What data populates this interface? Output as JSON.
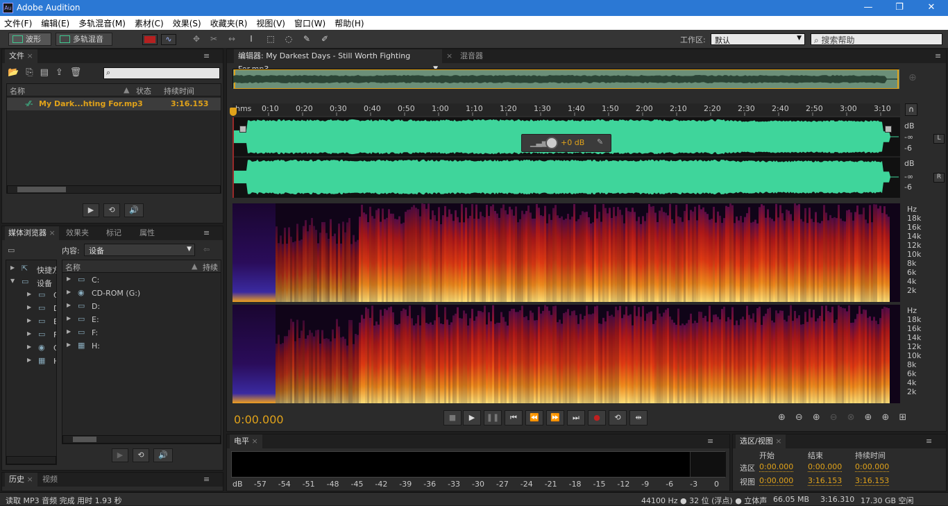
{
  "app": {
    "title": "Adobe Audition",
    "icon": "Au"
  },
  "window": {
    "min": "—",
    "max": "❐",
    "close": "✕"
  },
  "menu": [
    "文件(F)",
    "编辑(E)",
    "多轨混音(M)",
    "素材(C)",
    "效果(S)",
    "收藏夹(R)",
    "视图(V)",
    "窗口(W)",
    "帮助(H)"
  ],
  "toolbar": {
    "waveform": "波形",
    "multitrack": "多轨混音",
    "workspace_label": "工作区:",
    "workspace_value": "默认",
    "search_placeholder": "搜索帮助"
  },
  "files": {
    "tab": "文件",
    "cols": [
      "名称",
      "状态",
      "持续时间"
    ],
    "items": [
      {
        "name": "My Dark...hting For.mp3",
        "duration": "3:16.153"
      }
    ]
  },
  "media": {
    "tabs": [
      "媒体浏览器",
      "效果夹",
      "标记",
      "属性"
    ],
    "content_label": "内容:",
    "content_value": "设备",
    "left_items": [
      "快捷方",
      "设备",
      "C:",
      "D:",
      "E:",
      "F:",
      "C:",
      "H:"
    ],
    "right_header": [
      "名称",
      "持续"
    ],
    "right_items": [
      "C:",
      "CD-ROM (G:)",
      "D:",
      "E:",
      "F:",
      "H:"
    ]
  },
  "history": {
    "tabs": [
      "历史",
      "视频"
    ]
  },
  "editor": {
    "tab": "编辑器: My Darkest Days - Still Worth Fighting For.mp3",
    "mixer": "混音器",
    "time": "0:00.000",
    "volume": "+0 dB",
    "ruler": [
      "hms",
      "0:10",
      "0:20",
      "0:30",
      "0:40",
      "0:50",
      "1:00",
      "1:10",
      "1:20",
      "1:30",
      "1:40",
      "1:50",
      "2:00",
      "2:10",
      "2:20",
      "2:30",
      "2:40",
      "2:50",
      "3:00",
      "3:10"
    ],
    "db_scale": [
      "dB",
      "-∞",
      "-6"
    ],
    "channels": [
      "L",
      "R"
    ],
    "hz_scale": [
      "Hz",
      "18k",
      "16k",
      "14k",
      "12k",
      "10k",
      "8k",
      "6k",
      "4k",
      "2k"
    ]
  },
  "level": {
    "tab": "电平",
    "scale": [
      "dB",
      "-57",
      "-54",
      "-51",
      "-48",
      "-45",
      "-42",
      "-39",
      "-36",
      "-33",
      "-30",
      "-27",
      "-24",
      "-21",
      "-18",
      "-15",
      "-12",
      "-9",
      "-6",
      "-3",
      "0"
    ]
  },
  "selection": {
    "tab": "选区/视图",
    "cols": [
      "开始",
      "结束",
      "持续时间"
    ],
    "rows": [
      {
        "label": "选区",
        "start": "0:00.000",
        "end": "0:00.000",
        "duration": "0:00.000"
      },
      {
        "label": "视图",
        "start": "0:00.000",
        "end": "3:16.153",
        "duration": "3:16.153"
      }
    ]
  },
  "status": {
    "left": "读取 MP3 音频 完成 用时 1.93 秒",
    "rate": "44100 Hz ● 32 位 (浮点) ● 立体声",
    "size": "66.05 MB",
    "dur": "3:16.310",
    "free": "17.30 GB 空闲"
  },
  "colors": {
    "wave": "#3fd59b",
    "accent": "#e0a21a",
    "titlebar": "#2b78d4"
  }
}
